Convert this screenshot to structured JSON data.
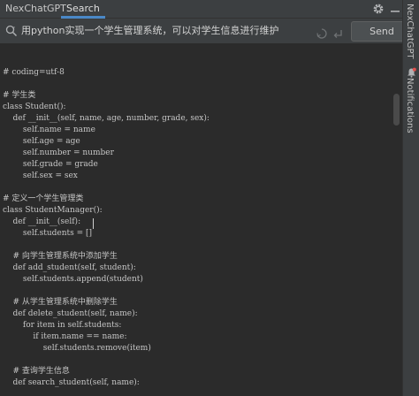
{
  "tabs": {
    "app": "NexChatGPT",
    "search": "Search"
  },
  "search": {
    "query": "用python实现一个学生管理系统，可以对学生信息进行维护",
    "send_label": "Send"
  },
  "sidebar": {
    "chat_label": "NexChatGPT",
    "notifications_label": "Notifications"
  },
  "code_lines": [
    "# coding=utf-8",
    "",
    "# 学生类",
    "class Student():",
    "    def __init__(self, name, age, number, grade, sex):",
    "        self.name = name",
    "        self.age = age",
    "        self.number = number",
    "        self.grade = grade",
    "        self.sex = sex",
    "",
    "# 定义一个学生管理类",
    "class StudentManager():",
    "    def __init__(self):",
    "        self.students = []",
    "",
    "    # 向学生管理系统中添加学生",
    "    def add_student(self, student):",
    "        self.students.append(student)",
    "",
    "    # 从学生管理系统中删除学生",
    "    def delete_student(self, name):",
    "        for item in self.students:",
    "            if item.name == name:",
    "                self.students.remove(item)",
    "",
    "    # 查询学生信息",
    "    def search_student(self, name):"
  ],
  "icons": {
    "settings": "gear-icon",
    "minimize": "minimize-icon",
    "search": "search-icon",
    "cancel": "cancel-icon",
    "enter": "enter-icon",
    "notifications": "bell-icon"
  },
  "colors": {
    "accent": "#4a88c7",
    "editor_bg": "#2b2b2b",
    "panel_bg": "#3c3f41"
  }
}
